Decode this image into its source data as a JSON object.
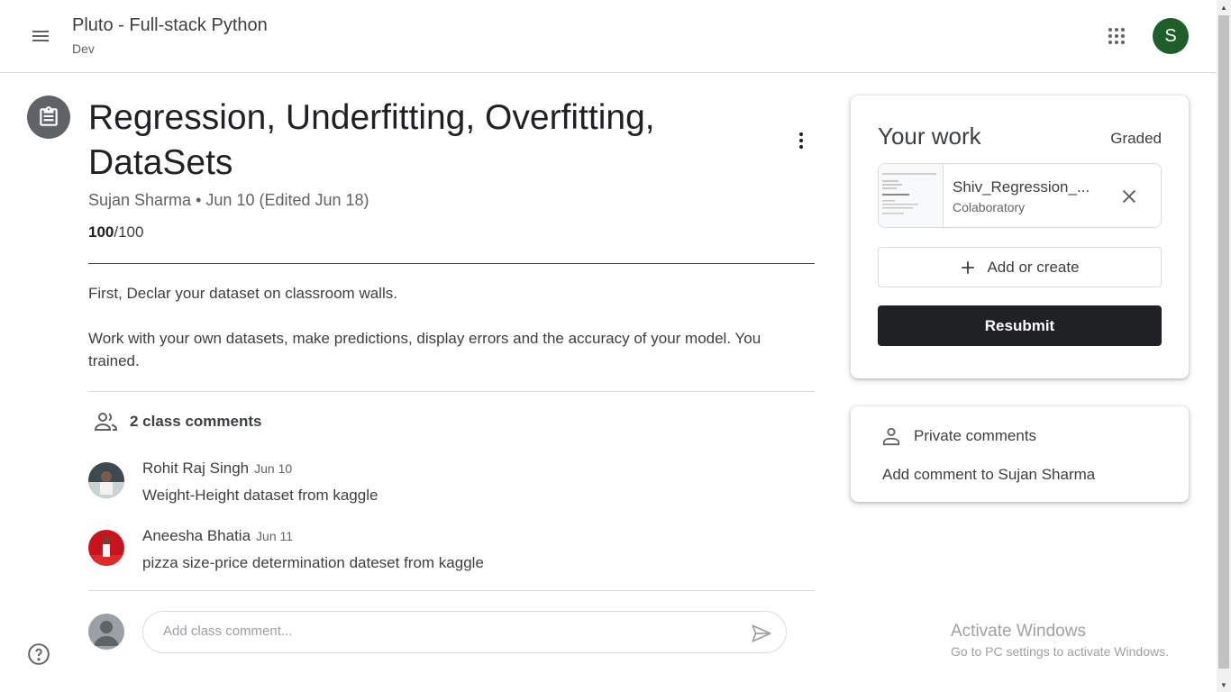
{
  "header": {
    "class_title": "Pluto - Full-stack Python",
    "class_section": "Dev",
    "user_initial": "S",
    "avatar_color": "#1e5e2a"
  },
  "assignment": {
    "title": "Regression, Underfitting, Overfitting, DataSets",
    "author": "Sujan Sharma",
    "date": "Jun 10 (Edited Jun 18)",
    "points_earned": "100",
    "points_total": "/100",
    "description": [
      "First, Declar your dataset on classroom walls.",
      "Work with your own datasets, make predictions, display errors and the accuracy of your model. You trained."
    ]
  },
  "comments": {
    "header": "2 class comments",
    "items": [
      {
        "author": "Rohit Raj Singh",
        "date": "Jun 10",
        "text": "Weight-Height dataset from kaggle"
      },
      {
        "author": "Aneesha Bhatia",
        "date": "Jun 11",
        "text": "pizza size-price determination dateset from kaggle"
      }
    ],
    "input_placeholder": "Add class comment..."
  },
  "your_work": {
    "title": "Your work",
    "status": "Graded",
    "attachment": {
      "name": "Shiv_Regression_...",
      "type": "Colaboratory"
    },
    "add_label": "Add or create",
    "resubmit_label": "Resubmit"
  },
  "private_comments": {
    "title": "Private comments",
    "add_label": "Add comment to Sujan Sharma"
  },
  "watermark": {
    "line1": "Activate Windows",
    "line2": "Go to PC settings to activate Windows."
  },
  "icons": [
    "menu-icon",
    "apps-icon",
    "assignment-icon",
    "more-vert-icon",
    "people-icon",
    "send-icon",
    "close-icon",
    "plus-icon",
    "person-icon",
    "help-icon"
  ]
}
